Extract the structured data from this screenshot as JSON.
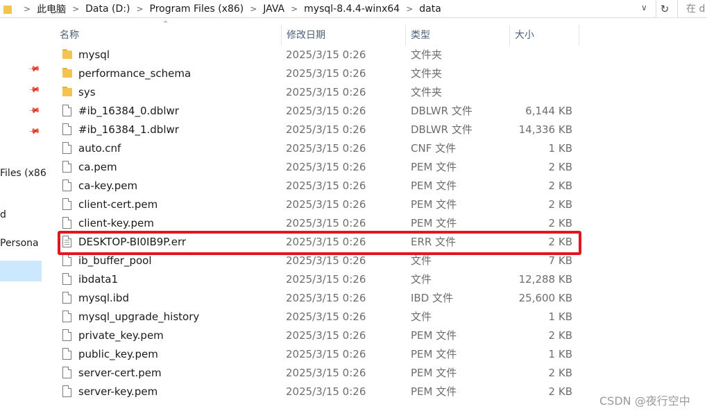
{
  "address": {
    "breadcrumbs": [
      "此电脑",
      "Data (D:)",
      "Program Files (x86)",
      "JAVA",
      "mysql-8.4.4-winx64",
      "data"
    ],
    "separator": ">",
    "dropdown_icon": "chevron-down-icon",
    "refresh_icon": "refresh-icon",
    "search_placeholder": "在 d"
  },
  "nav": {
    "pins": [
      "pin-icon",
      "pin-icon",
      "pin-icon",
      "pin-icon"
    ],
    "items": [
      {
        "label": "Files (x86"
      },
      {
        "label": "d"
      },
      {
        "label": "Persona"
      }
    ]
  },
  "columns": {
    "name": "名称",
    "date": "修改日期",
    "type": "类型",
    "size": "大小"
  },
  "files": [
    {
      "name": "mysql",
      "date": "2025/3/15 0:26",
      "type": "文件夹",
      "size": "",
      "kind": "folder"
    },
    {
      "name": "performance_schema",
      "date": "2025/3/15 0:26",
      "type": "文件夹",
      "size": "",
      "kind": "folder"
    },
    {
      "name": "sys",
      "date": "2025/3/15 0:26",
      "type": "文件夹",
      "size": "",
      "kind": "folder"
    },
    {
      "name": "#ib_16384_0.dblwr",
      "date": "2025/3/15 0:26",
      "type": "DBLWR 文件",
      "size": "6,144 KB",
      "kind": "file"
    },
    {
      "name": "#ib_16384_1.dblwr",
      "date": "2025/3/15 0:26",
      "type": "DBLWR 文件",
      "size": "14,336 KB",
      "kind": "file"
    },
    {
      "name": "auto.cnf",
      "date": "2025/3/15 0:26",
      "type": "CNF 文件",
      "size": "1 KB",
      "kind": "file"
    },
    {
      "name": "ca.pem",
      "date": "2025/3/15 0:26",
      "type": "PEM 文件",
      "size": "2 KB",
      "kind": "file"
    },
    {
      "name": "ca-key.pem",
      "date": "2025/3/15 0:26",
      "type": "PEM 文件",
      "size": "2 KB",
      "kind": "file"
    },
    {
      "name": "client-cert.pem",
      "date": "2025/3/15 0:26",
      "type": "PEM 文件",
      "size": "2 KB",
      "kind": "file"
    },
    {
      "name": "client-key.pem",
      "date": "2025/3/15 0:26",
      "type": "PEM 文件",
      "size": "2 KB",
      "kind": "file"
    },
    {
      "name": "DESKTOP-BI0IB9P.err",
      "date": "2025/3/15 0:26",
      "type": "ERR 文件",
      "size": "2 KB",
      "kind": "text"
    },
    {
      "name": "ib_buffer_pool",
      "date": "2025/3/15 0:26",
      "type": "文件",
      "size": "7 KB",
      "kind": "file"
    },
    {
      "name": "ibdata1",
      "date": "2025/3/15 0:26",
      "type": "文件",
      "size": "12,288 KB",
      "kind": "file"
    },
    {
      "name": "mysql.ibd",
      "date": "2025/3/15 0:26",
      "type": "IBD 文件",
      "size": "25,600 KB",
      "kind": "file"
    },
    {
      "name": "mysql_upgrade_history",
      "date": "2025/3/15 0:26",
      "type": "文件",
      "size": "1 KB",
      "kind": "file"
    },
    {
      "name": "private_key.pem",
      "date": "2025/3/15 0:26",
      "type": "PEM 文件",
      "size": "2 KB",
      "kind": "file"
    },
    {
      "name": "public_key.pem",
      "date": "2025/3/15 0:26",
      "type": "PEM 文件",
      "size": "1 KB",
      "kind": "file"
    },
    {
      "name": "server-cert.pem",
      "date": "2025/3/15 0:26",
      "type": "PEM 文件",
      "size": "2 KB",
      "kind": "file"
    },
    {
      "name": "server-key.pem",
      "date": "2025/3/15 0:26",
      "type": "PEM 文件",
      "size": "2 KB",
      "kind": "file"
    }
  ],
  "highlight": {
    "file": "DESKTOP-BI0IB9P.err",
    "color": "#e3161f"
  },
  "watermark": "CSDN @夜行空中",
  "colors": {
    "folder": "#f3c44f",
    "selection": "#cce8ff",
    "header_text": "#4c607a"
  }
}
